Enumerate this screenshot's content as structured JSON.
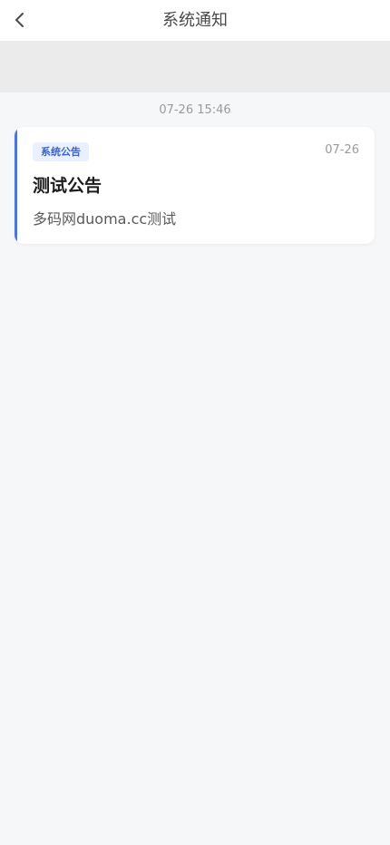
{
  "header": {
    "title": "系统通知",
    "back_icon": "chevron-left-icon"
  },
  "notifications": [
    {
      "time": "07-26 15:46",
      "badge": "系统公告",
      "date": "07-26",
      "title": "测试公告",
      "content": "多码网duoma.cc测试"
    }
  ],
  "colors": {
    "accent": "#4d74d6",
    "badge_bg": "#eaf0ff",
    "badge_text": "#3d62c8"
  }
}
